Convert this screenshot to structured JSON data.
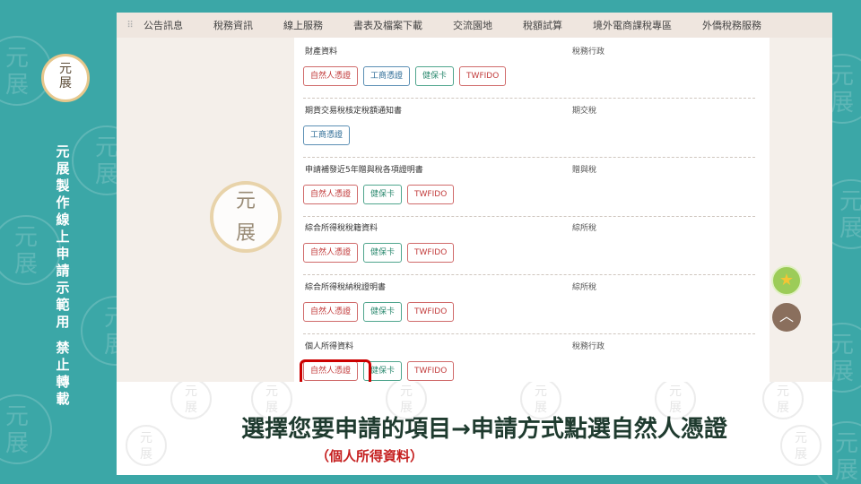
{
  "logo": {
    "line1": "元",
    "line2": "展"
  },
  "vertical_title": [
    "元",
    "展",
    "製",
    "作",
    "線",
    "上",
    "申",
    "請",
    "示",
    "範",
    "用",
    "",
    "禁",
    "止",
    "轉",
    "載"
  ],
  "nav": {
    "items": [
      "公告訊息",
      "稅務資訊",
      "線上服務",
      "書表及檔案下載",
      "交流園地",
      "稅額試算",
      "境外電商課稅專區",
      "外僑稅務服務"
    ]
  },
  "rows": [
    {
      "name": "財產資料",
      "category": "稅務行政",
      "buttons": [
        {
          "label": "自然人憑證",
          "style": "red"
        },
        {
          "label": "工商憑證",
          "style": "blue"
        },
        {
          "label": "健保卡",
          "style": "green"
        },
        {
          "label": "TWFIDO",
          "style": "red"
        }
      ]
    },
    {
      "name": "期貨交易稅核定稅額通知書",
      "category": "期交稅",
      "buttons": [
        {
          "label": "工商憑證",
          "style": "blue"
        }
      ]
    },
    {
      "name": "申請補發近5年贈與稅各項證明書",
      "category": "贈與稅",
      "buttons": [
        {
          "label": "自然人憑證",
          "style": "red"
        },
        {
          "label": "健保卡",
          "style": "green"
        },
        {
          "label": "TWFIDO",
          "style": "red"
        }
      ]
    },
    {
      "name": "綜合所得稅稅籍資料",
      "category": "綜所稅",
      "buttons": [
        {
          "label": "自然人憑證",
          "style": "red"
        },
        {
          "label": "健保卡",
          "style": "green"
        },
        {
          "label": "TWFIDO",
          "style": "red"
        }
      ]
    },
    {
      "name": "綜合所得稅納稅證明書",
      "category": "綜所稅",
      "buttons": [
        {
          "label": "自然人憑證",
          "style": "red"
        },
        {
          "label": "健保卡",
          "style": "green"
        },
        {
          "label": "TWFIDO",
          "style": "red"
        }
      ]
    },
    {
      "name": "個人所得資料",
      "category": "稅務行政",
      "buttons": [
        {
          "label": "自然人憑證",
          "style": "red"
        },
        {
          "label": "健保卡",
          "style": "green"
        },
        {
          "label": "TWFIDO",
          "style": "red"
        }
      ]
    }
  ],
  "center_logo": {
    "line1": "元",
    "line2": "展"
  },
  "caption": {
    "main": "選擇您要申請的項目→申請方式點選自然人憑證",
    "sub": "（個人所得資料）"
  },
  "icons": {
    "badge": "award-icon",
    "scroll_top": "chevron-up-icon"
  }
}
